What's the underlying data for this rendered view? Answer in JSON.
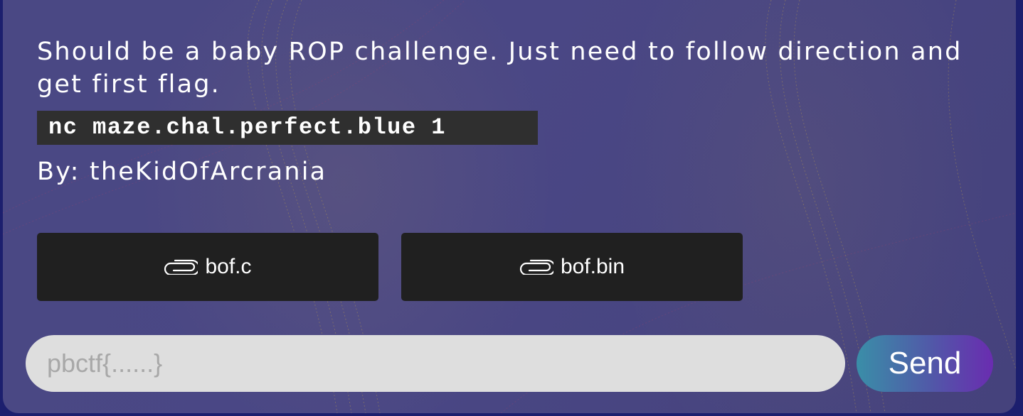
{
  "challenge": {
    "description": "Should be a baby ROP challenge. Just need to follow direction and get first flag.",
    "command": "nc maze.chal.perfect.blue 1",
    "author": "By: theKidOfArcrania"
  },
  "attachments": [
    {
      "name": "bof.c",
      "icon": "paperclip-icon"
    },
    {
      "name": "bof.bin",
      "icon": "paperclip-icon"
    }
  ],
  "flag_form": {
    "placeholder": "pbctf{......}",
    "value": "",
    "submit_label": "Send"
  },
  "colors": {
    "card_background": "#4a4884",
    "page_background": "#1c1f6e",
    "code_background": "#2f2f2f",
    "button_background": "#202020",
    "input_background": "#dedede",
    "send_gradient": [
      "#3a8ea8",
      "#5158a8",
      "#6a2cb0"
    ]
  }
}
